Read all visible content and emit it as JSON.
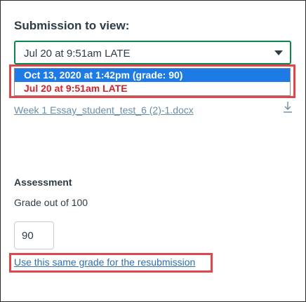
{
  "submission": {
    "heading": "Submission to view:",
    "selected_value": "Jul 20 at 9:51am LATE",
    "options": [
      {
        "label": "Oct 13, 2020 at 1:42pm (grade: 90)"
      },
      {
        "label": "Jul 20 at 9:51am LATE"
      }
    ],
    "file_link": "Week 1 Essay_student_test_6 (2)-1.docx"
  },
  "assessment": {
    "heading": "Assessment",
    "grade_label": "Grade out of 100",
    "grade_value": "90",
    "resubmission_link": "Use this same grade for the resubmission"
  },
  "icons": {
    "caret": "chevron-down-icon",
    "download": "download-icon"
  },
  "colors": {
    "select_border": "#0b874b",
    "option_highlight": "#1e7be6",
    "late_text": "#d0232d",
    "annotation_box": "#e0474c",
    "link": "#2d6fb0"
  }
}
